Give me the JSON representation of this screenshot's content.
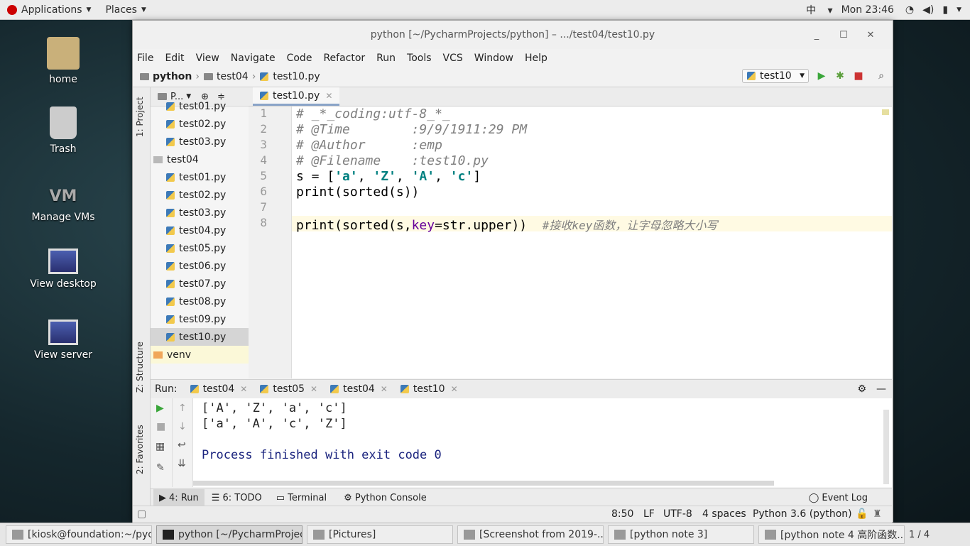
{
  "topbar": {
    "applications": "Applications",
    "places": "Places",
    "lang": "中",
    "clock": "Mon 23:46"
  },
  "desktop": {
    "icons": [
      "home",
      "Trash",
      "Manage VMs",
      "View desktop",
      "View server"
    ]
  },
  "window": {
    "title": "python [~/PycharmProjects/python] – .../test04/test10.py"
  },
  "menu": [
    "File",
    "Edit",
    "View",
    "Navigate",
    "Code",
    "Refactor",
    "Run",
    "Tools",
    "VCS",
    "Window",
    "Help"
  ],
  "breadcrumb": [
    "python",
    "test04",
    "test10.py"
  ],
  "run_config": "test10",
  "project": {
    "header": "P...",
    "items": [
      "test01.py",
      "test02.py",
      "test03.py",
      "test04",
      "test01.py",
      "test02.py",
      "test03.py",
      "test04.py",
      "test05.py",
      "test06.py",
      "test07.py",
      "test08.py",
      "test09.py",
      "test10.py",
      "venv"
    ]
  },
  "sidetabs": {
    "project": "1: Project",
    "structure": "Z: Structure",
    "favorites": "2: Favorites"
  },
  "editor": {
    "tab": "test10.py",
    "lines": [
      "1",
      "2",
      "3",
      "4",
      "5",
      "6",
      "7",
      "8"
    ],
    "code": {
      "l1": "# _*_coding:utf-8_*_",
      "l2": "# @Time        :9/9/1911:29 PM",
      "l3": "# @Author      :emp",
      "l4": "# @Filename    :test10.py",
      "l5a": "s = [",
      "l5b": "'a'",
      "l5c": ", ",
      "l5d": "'Z'",
      "l5e": ", ",
      "l5f": "'A'",
      "l5g": ", ",
      "l5h": "'c'",
      "l5i": "]",
      "l6": "print(sorted(s))",
      "l8a": "print(sorted(s,",
      "l8b": "key",
      "l8c": "=str.upper))  ",
      "l8d": "#接收key函数，让字母忽略大小写"
    }
  },
  "run": {
    "label": "Run:",
    "tabs": [
      "test04",
      "test05",
      "test04",
      "test10"
    ],
    "output": [
      "['A', 'Z', 'a', 'c']",
      "['a', 'A', 'c', 'Z']",
      "",
      "Process finished with exit code 0"
    ]
  },
  "bottom_tabs": [
    "4: Run",
    "6: TODO",
    "Terminal",
    "Python Console"
  ],
  "event_log": "Event Log",
  "status": {
    "position": "8:50",
    "line_sep": "LF",
    "encoding": "UTF-8",
    "indent": "4 spaces",
    "interpreter": "Python 3.6 (python)"
  },
  "taskbar": [
    "[kiosk@foundation:~/pyc...",
    "python [~/PycharmProjec...",
    "[Pictures]",
    "[Screenshot from 2019-...",
    "[python note 3]",
    "[python note 4 高阶函数..."
  ],
  "taskbar_pager": "1 / 4"
}
